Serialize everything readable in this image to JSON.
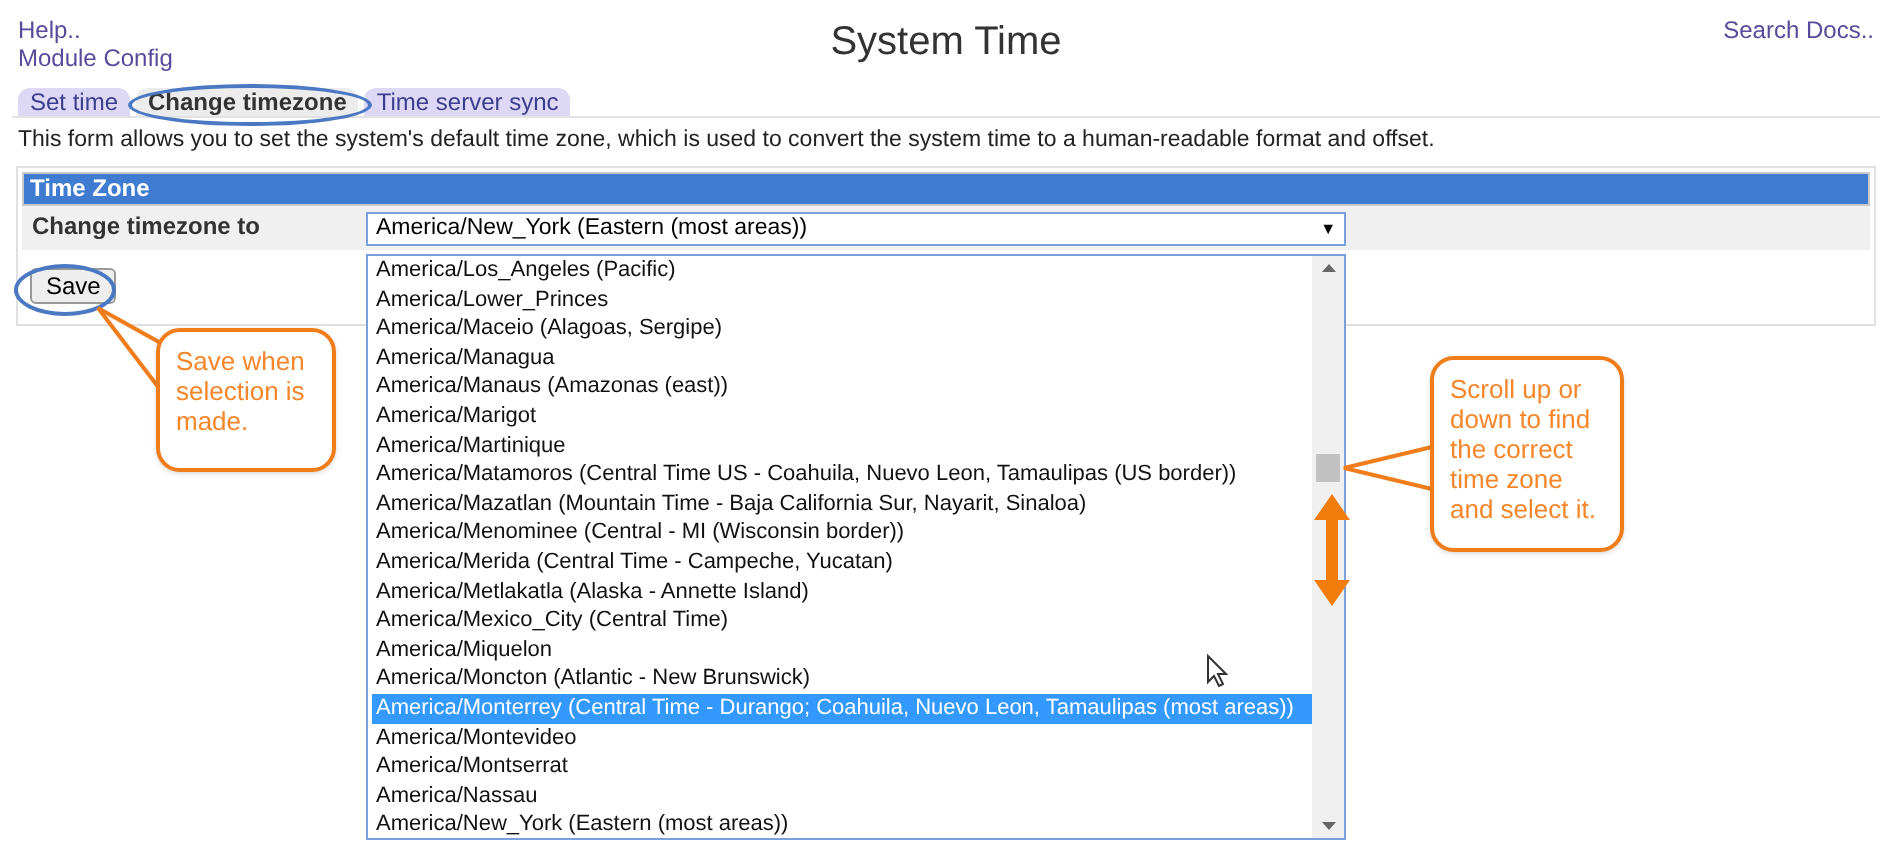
{
  "header": {
    "links": [
      "Help..",
      "Module Config"
    ],
    "title": "System Time",
    "search_link": "Search Docs.."
  },
  "tabs": [
    {
      "label": "Set time",
      "selected": false
    },
    {
      "label": "Change timezone",
      "selected": true
    },
    {
      "label": "Time server sync",
      "selected": false
    }
  ],
  "description": "This form allows you to set the system's default time zone, which is used to convert the system time to a human-readable format and offset.",
  "section": {
    "title": "Time Zone",
    "field_label": "Change timezone to",
    "select_value": "America/New_York (Eastern (most areas))",
    "arrow": "▼"
  },
  "options": [
    {
      "label": "America/Los_Angeles (Pacific)",
      "selected": false
    },
    {
      "label": "America/Lower_Princes",
      "selected": false
    },
    {
      "label": "America/Maceio (Alagoas, Sergipe)",
      "selected": false
    },
    {
      "label": "America/Managua",
      "selected": false
    },
    {
      "label": "America/Manaus (Amazonas (east))",
      "selected": false
    },
    {
      "label": "America/Marigot",
      "selected": false
    },
    {
      "label": "America/Martinique",
      "selected": false
    },
    {
      "label": "America/Matamoros (Central Time US - Coahuila, Nuevo Leon, Tamaulipas (US border))",
      "selected": false
    },
    {
      "label": "America/Mazatlan (Mountain Time - Baja California Sur, Nayarit, Sinaloa)",
      "selected": false
    },
    {
      "label": "America/Menominee (Central - MI (Wisconsin border))",
      "selected": false
    },
    {
      "label": "America/Merida (Central Time - Campeche, Yucatan)",
      "selected": false
    },
    {
      "label": "America/Metlakatla (Alaska - Annette Island)",
      "selected": false
    },
    {
      "label": "America/Mexico_City (Central Time)",
      "selected": false
    },
    {
      "label": "America/Miquelon",
      "selected": false
    },
    {
      "label": "America/Moncton (Atlantic - New Brunswick)",
      "selected": false
    },
    {
      "label": "America/Monterrey (Central Time - Durango; Coahuila, Nuevo Leon, Tamaulipas (most areas))",
      "selected": true
    },
    {
      "label": "America/Montevideo",
      "selected": false
    },
    {
      "label": "America/Montserrat",
      "selected": false
    },
    {
      "label": "America/Nassau",
      "selected": false
    },
    {
      "label": "America/New_York (Eastern (most areas))",
      "selected": false
    }
  ],
  "save_button": "Save",
  "callouts": [
    "Save when selection is made.",
    "Scroll up or down to find the correct time zone and select it."
  ]
}
